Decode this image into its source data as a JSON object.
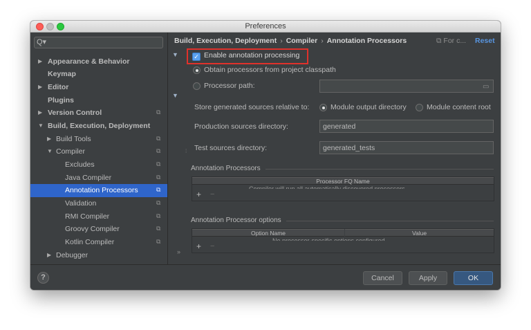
{
  "window": {
    "title": "Preferences"
  },
  "sidebar": {
    "search_placeholder": "",
    "items": [
      {
        "label": "Appearance & Behavior"
      },
      {
        "label": "Keymap"
      },
      {
        "label": "Editor"
      },
      {
        "label": "Plugins"
      },
      {
        "label": "Version Control"
      },
      {
        "label": "Build, Execution, Deployment"
      },
      {
        "label": "Build Tools"
      },
      {
        "label": "Compiler"
      },
      {
        "label": "Excludes"
      },
      {
        "label": "Java Compiler"
      },
      {
        "label": "Annotation Processors"
      },
      {
        "label": "Validation"
      },
      {
        "label": "RMI Compiler"
      },
      {
        "label": "Groovy Compiler"
      },
      {
        "label": "Kotlin Compiler"
      },
      {
        "label": "Debugger"
      }
    ]
  },
  "breadcrumb": {
    "items": [
      "Build, Execution, Deployment",
      "Compiler",
      "Annotation Processors"
    ],
    "for_current": "For c...",
    "reset": "Reset"
  },
  "options": {
    "enable_label": "Enable annotation processing",
    "enable_checked": true,
    "obtain_label": "Obtain processors from project classpath",
    "processor_path_label": "Processor path:",
    "processor_path_value": "",
    "store_label": "Store generated sources relative to:",
    "module_output_label": "Module output directory",
    "module_content_label": "Module content root",
    "production_label": "Production sources directory:",
    "production_value": "generated",
    "test_label": "Test sources directory:",
    "test_value": "generated_tests"
  },
  "annotation_processors": {
    "title": "Annotation Processors",
    "column": "Processor FQ Name",
    "empty_text": "Compiler will run all automatically discovered processors"
  },
  "processor_options": {
    "title": "Annotation Processor options",
    "columns": [
      "Option Name",
      "Value"
    ],
    "empty_text": "No processor-specific options configured"
  },
  "toolbar": {
    "add": "+",
    "remove": "−"
  },
  "buttons": {
    "help": "?",
    "cancel": "Cancel",
    "apply": "Apply",
    "ok": "OK"
  }
}
